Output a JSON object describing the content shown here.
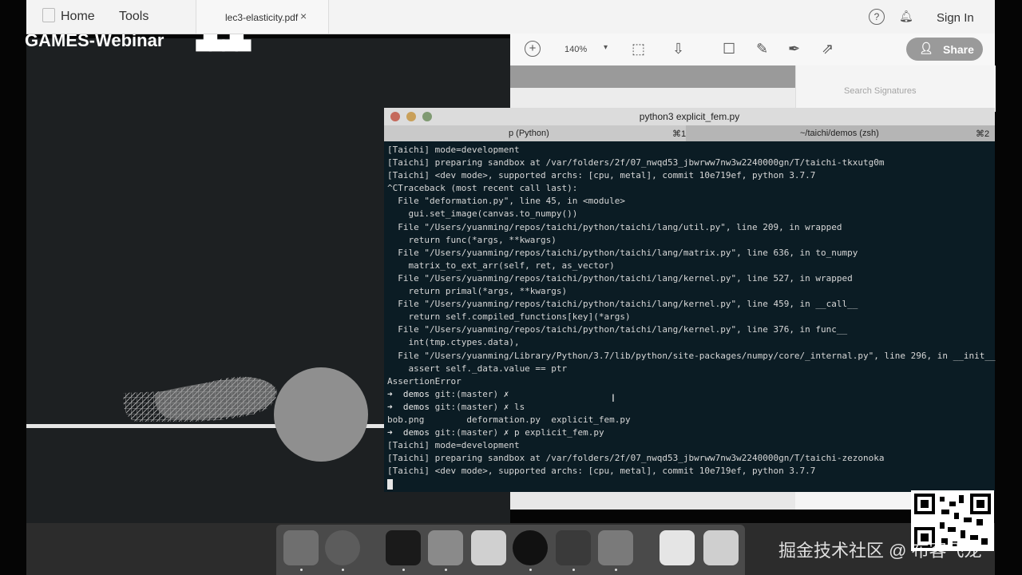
{
  "overlay": {
    "games_label": "GAMES-Webinar",
    "bili_label": "bilibili"
  },
  "acrobat": {
    "tabs": [
      "Home",
      "Tools"
    ],
    "file_tab": "lec3-elasticity.pdf",
    "file_tab_close": "×",
    "help_icon": "?",
    "bell_icon": "bell",
    "sign_in": "Sign In",
    "zoom": "140%",
    "zoom_chevron": "▾",
    "share_label": "Share",
    "search_signatures": "Search Signatures",
    "icons": [
      "zoom-in-icon",
      "select-icon",
      "download-icon",
      "comment-icon",
      "pen-icon",
      "sign-icon",
      "export-icon",
      "share-user-icon"
    ]
  },
  "terminal": {
    "title": "python3 explicit_fem.py",
    "tab1_label": "p (Python)",
    "tab1_shortcut": "⌘1",
    "tab2_label": "~/taichi/demos (zsh)",
    "tab2_shortcut": "⌘2",
    "lines": [
      "[Taichi] mode=development",
      "[Taichi] preparing sandbox at /var/folders/2f/07_nwqd53_jbwrww7nw3w2240000gn/T/taichi-tkxutg0m",
      "[Taichi] <dev mode>, supported archs: [cpu, metal], commit 10e719ef, python 3.7.7",
      "^CTraceback (most recent call last):",
      "  File \"deformation.py\", line 45, in <module>",
      "    gui.set_image(canvas.to_numpy())",
      "  File \"/Users/yuanming/repos/taichi/python/taichi/lang/util.py\", line 209, in wrapped",
      "    return func(*args, **kwargs)",
      "  File \"/Users/yuanming/repos/taichi/python/taichi/lang/matrix.py\", line 636, in to_numpy",
      "    matrix_to_ext_arr(self, ret, as_vector)",
      "  File \"/Users/yuanming/repos/taichi/python/taichi/lang/kernel.py\", line 527, in wrapped",
      "    return primal(*args, **kwargs)",
      "  File \"/Users/yuanming/repos/taichi/python/taichi/lang/kernel.py\", line 459, in __call__",
      "    return self.compiled_functions[key](*args)",
      "  File \"/Users/yuanming/repos/taichi/python/taichi/lang/kernel.py\", line 376, in func__",
      "    int(tmp.ctypes.data),",
      "  File \"/Users/yuanming/Library/Python/3.7/lib/python/site-packages/numpy/core/_internal.py\", line 296, in __init__",
      "    assert self._data.value == ptr",
      "AssertionError"
    ],
    "prompt": {
      "arrow": "➜",
      "dir": "demos",
      "git": "git:(master)",
      "dirty": "✗"
    },
    "cmd1": "",
    "cmd2": "ls",
    "ls_output": "bob.png        deformation.py  explicit_fem.py",
    "cmd3": "p explicit_fem.py",
    "lines2": [
      "[Taichi] mode=development",
      "[Taichi] preparing sandbox at /var/folders/2f/07_nwqd53_jbwrww7nw3w2240000gn/T/taichi-zezonoka",
      "[Taichi] <dev mode>, supported archs: [cpu, metal], commit 10e719ef, python 3.7.7"
    ],
    "ibeam": "I"
  },
  "dock": {
    "apps": [
      {
        "name": "finder-icon",
        "color": "#6f6f6f"
      },
      {
        "name": "chrome-icon",
        "color": "#5c5c5c"
      },
      {
        "name": "terminal-icon",
        "color": "#1a1a1a"
      },
      {
        "name": "keynote-icon",
        "color": "#8a8a8a"
      },
      {
        "name": "pages-icon",
        "color": "#d0d0d0"
      },
      {
        "name": "obs-icon",
        "color": "#111111"
      },
      {
        "name": "acrobat-icon",
        "color": "#3a3a3a"
      },
      {
        "name": "rocket-icon",
        "color": "#7a7a7a"
      },
      {
        "name": "documents-folder-icon",
        "color": "#e5e5e5"
      },
      {
        "name": "trash-icon",
        "color": "#cfcfcf"
      }
    ]
  },
  "watermark": "掘金技术社区 @ 布客飞龙",
  "qr_label": "qr-code"
}
